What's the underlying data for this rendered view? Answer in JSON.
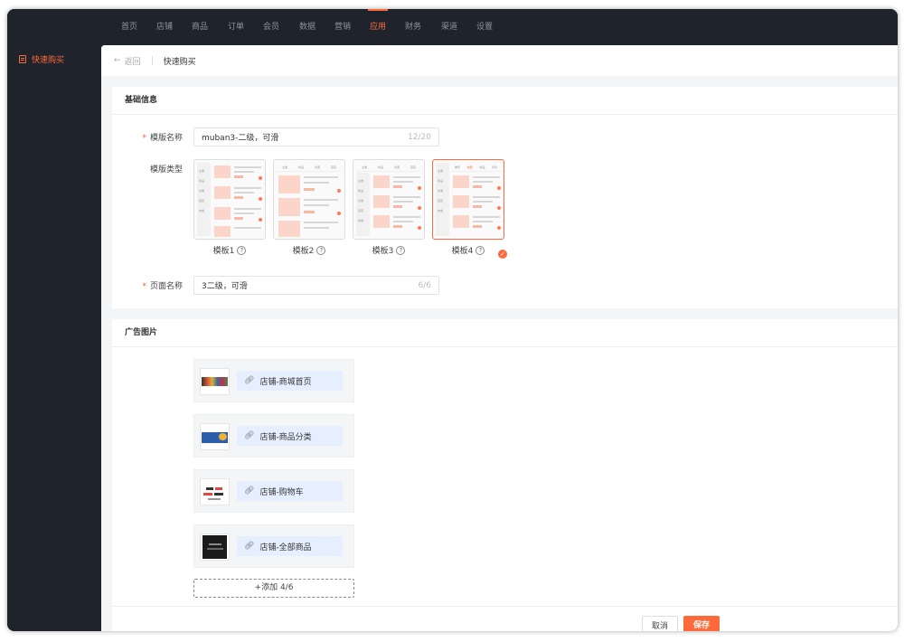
{
  "topnav": {
    "items": [
      {
        "label": "首页"
      },
      {
        "label": "店铺"
      },
      {
        "label": "商品"
      },
      {
        "label": "订单"
      },
      {
        "label": "会员"
      },
      {
        "label": "数据"
      },
      {
        "label": "营销"
      },
      {
        "label": "应用"
      },
      {
        "label": "财务"
      },
      {
        "label": "渠道"
      },
      {
        "label": "设置"
      }
    ],
    "active_index": 7
  },
  "sidebar": {
    "items": [
      {
        "label": "快速购买",
        "icon": "doc-icon",
        "active": true
      }
    ]
  },
  "breadcrumb": {
    "back_label": "返回",
    "current": "快速购买"
  },
  "basic_info": {
    "title": "基础信息",
    "template_name": {
      "label": "模版名称",
      "required": true,
      "value": "muban3-二级，可滑",
      "counter": "12/20"
    },
    "template_type": {
      "label": "模版类型",
      "options": [
        {
          "label": "模板1",
          "selected": false
        },
        {
          "label": "模板2",
          "selected": false
        },
        {
          "label": "模板3",
          "selected": false
        },
        {
          "label": "模板4",
          "selected": true
        }
      ]
    },
    "page_name": {
      "label": "页面名称",
      "required": true,
      "value": "3二级，可滑",
      "counter": "6/6"
    }
  },
  "ad_images": {
    "title": "广告图片",
    "items": [
      {
        "link": "店铺-商城首页",
        "link_icon": "link-icon"
      },
      {
        "link": "店铺-商品分类",
        "link_icon": "link-icon"
      },
      {
        "link": "店铺-购物车",
        "link_icon": "link-icon"
      },
      {
        "link": "店铺-全部商品",
        "link_icon": "link-icon"
      }
    ],
    "add_label": "+添加 4/6"
  },
  "footer": {
    "cancel_label": "取消",
    "save_label": "保存"
  },
  "colors": {
    "accent": "#ff6a3c",
    "nav_bg": "#1f232b",
    "link_bg": "#e6efff"
  }
}
